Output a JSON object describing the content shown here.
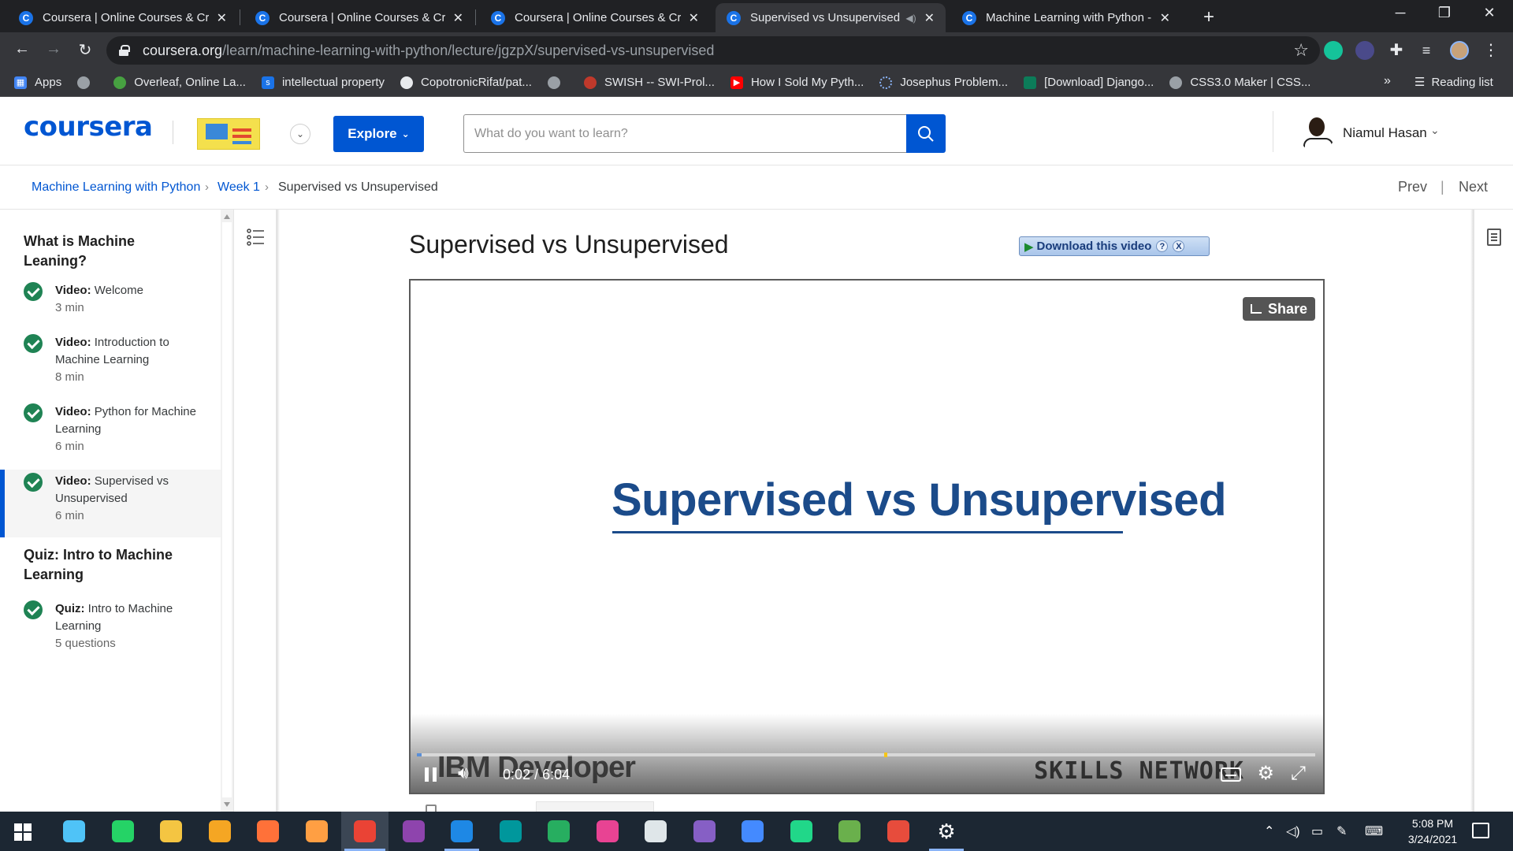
{
  "browser": {
    "tabs": [
      {
        "title": "Coursera | Online Courses & Credentials From Top Educators",
        "active": false
      },
      {
        "title": "Coursera | Online Courses & Credentials From Top Educators",
        "active": false
      },
      {
        "title": "Coursera | Online Courses & Credentials From Top Educators",
        "active": false
      },
      {
        "title": "Supervised vs Unsupervised | Coursera",
        "active": true,
        "audio": true
      },
      {
        "title": "Machine Learning with Python - IBM | Coursera",
        "active": false
      }
    ],
    "url_host": "coursera.org",
    "url_path": "/learn/machine-learning-with-python/lecture/jgzpX/supervised-vs-unsupervised",
    "bookmarks": [
      {
        "label": "Apps",
        "icon": "apps-grid-icon",
        "color": "#4285f4"
      },
      {
        "label": "",
        "icon": "globe-icon",
        "color": "#9aa0a6"
      },
      {
        "label": "Overleaf, Online La...",
        "icon": "overleaf-icon",
        "color": "#47a141"
      },
      {
        "label": "intellectual property",
        "icon": "s-icon",
        "color": "#1a73e8"
      },
      {
        "label": "CopotronicRifat/pat...",
        "icon": "github-icon",
        "color": "#24292e"
      },
      {
        "label": "",
        "icon": "globe-icon",
        "color": "#9aa0a6"
      },
      {
        "label": "SWISH -- SWI-Prol...",
        "icon": "swish-icon",
        "color": "#c0392b"
      },
      {
        "label": "How I Sold My Pyth...",
        "icon": "youtube-icon",
        "color": "#ff0000"
      },
      {
        "label": "Josephus Problem...",
        "icon": "loading-icon",
        "color": "#5f6368"
      },
      {
        "label": "[Download] Django...",
        "icon": "django-icon",
        "color": "#0c7c59"
      },
      {
        "label": "CSS3.0 Maker | CSS...",
        "icon": "globe-icon",
        "color": "#9aa0a6"
      }
    ],
    "bookmarks_more": "»",
    "reading_list": "Reading list"
  },
  "header": {
    "logo": "coursera",
    "explore": "Explore",
    "search_placeholder": "What do you want to learn?",
    "username": "Niamul Hasan"
  },
  "breadcrumb": {
    "course": "Machine Learning with Python",
    "week": "Week 1",
    "current": "Supervised vs Unsupervised",
    "prev": "Prev",
    "next": "Next",
    "divider": "|"
  },
  "sidebar": {
    "groups": [
      {
        "title": "What is Machine Leaning?",
        "items": [
          {
            "kind": "Video:",
            "name": "Welcome",
            "meta": "3 min",
            "active": false
          },
          {
            "kind": "Video:",
            "name": "Introduction to Machine Learning",
            "meta": "8 min",
            "active": false
          },
          {
            "kind": "Video:",
            "name": "Python for Machine Learning",
            "meta": "6 min",
            "active": false
          },
          {
            "kind": "Video:",
            "name": "Supervised vs Unsupervised",
            "meta": "6 min",
            "active": true
          }
        ]
      },
      {
        "title": "Quiz: Intro to Machine Learning",
        "items": [
          {
            "kind": "Quiz:",
            "name": "Intro to Machine Learning",
            "meta": "5 questions",
            "active": false
          }
        ]
      }
    ]
  },
  "lecture": {
    "title": "Supervised vs Unsupervised",
    "download_button": "Download this video",
    "download_help": "?",
    "download_close": "X"
  },
  "video": {
    "slide_title": "Supervised vs Unsupervised",
    "share": "Share",
    "watermark_left": "IBM Developer",
    "watermark_right": "SKILLS NETWORK",
    "current_time": "0:02",
    "time_separator": "/",
    "duration": "6:04",
    "progress_fraction": 0.0055,
    "marker_fraction": 0.52
  },
  "taskbar": {
    "apps": [
      {
        "name": "search",
        "color": "#4fc3f7",
        "state": "none"
      },
      {
        "name": "whatsapp",
        "color": "#25d366",
        "state": "none"
      },
      {
        "name": "file-explorer",
        "color": "#f4c542",
        "state": "none"
      },
      {
        "name": "tor",
        "color": "#f5a623",
        "state": "none"
      },
      {
        "name": "firefox",
        "color": "#ff7139",
        "state": "none"
      },
      {
        "name": "pdf-reader",
        "color": "#ff9f43",
        "state": "none"
      },
      {
        "name": "chrome",
        "color": "#ea4335",
        "state": "active"
      },
      {
        "name": "github-desktop",
        "color": "#8e44ad",
        "state": "none"
      },
      {
        "name": "vscode",
        "color": "#1e88e5",
        "state": "running"
      },
      {
        "name": "arduino",
        "color": "#00979c",
        "state": "none"
      },
      {
        "name": "globe-app",
        "color": "#27ae60",
        "state": "none"
      },
      {
        "name": "paint-app",
        "color": "#e84393",
        "state": "none"
      },
      {
        "name": "inkscape",
        "color": "#dfe6e9",
        "state": "none"
      },
      {
        "name": "visual-studio",
        "color": "#865fc5",
        "state": "none"
      },
      {
        "name": "messenger",
        "color": "#448aff",
        "state": "none"
      },
      {
        "name": "pycharm",
        "color": "#21d789",
        "state": "none"
      },
      {
        "name": "notepad",
        "color": "#6ab04c",
        "state": "none"
      },
      {
        "name": "game-app",
        "color": "#e74c3c",
        "state": "none"
      },
      {
        "name": "settings",
        "color": "#ffffff",
        "state": "running"
      }
    ],
    "time": "5:08 PM",
    "date": "3/24/2021"
  }
}
